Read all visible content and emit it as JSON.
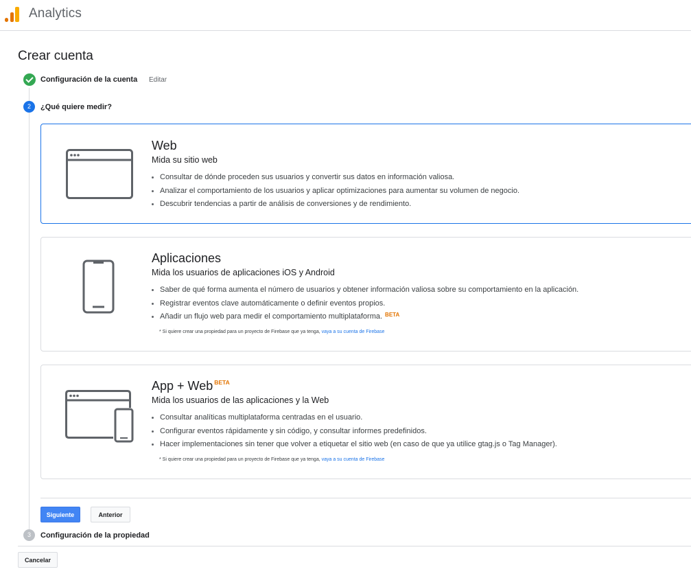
{
  "app": {
    "title": "Analytics"
  },
  "page": {
    "title": "Crear cuenta"
  },
  "steps": {
    "step1": {
      "title": "Configuración de la cuenta",
      "edit_label": "Editar"
    },
    "step2": {
      "number": "2",
      "title": "¿Qué quiere medir?"
    },
    "step3": {
      "number": "3",
      "title": "Configuración de la propiedad"
    }
  },
  "cards": {
    "web": {
      "title": "Web",
      "subtitle": "Mida su sitio web",
      "bullets": [
        "Consultar de dónde proceden sus usuarios y convertir sus datos en información valiosa.",
        "Analizar el comportamiento de los usuarios y aplicar optimizaciones para aumentar su volumen de negocio.",
        "Descubrir tendencias a partir de análisis de conversiones y de rendimiento."
      ],
      "icon": "browser-window-icon"
    },
    "apps": {
      "title": "Aplicaciones",
      "subtitle": "Mida los usuarios de aplicaciones iOS y Android",
      "bullets": [
        "Saber de qué forma aumenta el número de usuarios y obtener información valiosa sobre su comportamiento en la aplicación.",
        "Registrar eventos clave automáticamente o definir eventos propios.",
        "Añadir un flujo web para medir el comportamiento multiplataforma."
      ],
      "beta": "BETA",
      "note": "* Si quiere crear una propiedad para un proyecto de Firebase que ya tenga, ",
      "note_link": "vaya a su cuenta de Firebase",
      "icon": "mobile-phone-icon"
    },
    "appweb": {
      "title": "App + Web",
      "beta": "BETA",
      "subtitle": "Mida los usuarios de las aplicaciones y la Web",
      "bullets": [
        "Consultar analíticas multiplataforma centradas en el usuario.",
        "Configurar eventos rápidamente y sin código, y consultar informes predefinidos.",
        "Hacer implementaciones sin tener que volver a etiquetar el sitio web (en caso de que ya utilice gtag.js o Tag Manager)."
      ],
      "note": "* Si quiere crear una propiedad para un proyecto de Firebase que ya tenga, ",
      "note_link": "vaya a su cuenta de Firebase",
      "icon": "browser-and-phone-icon"
    }
  },
  "buttons": {
    "next": "Siguiente",
    "previous": "Anterior",
    "cancel": "Cancelar"
  },
  "colors": {
    "accent": "#1a73e8",
    "primary_button": "#4285f4",
    "beta": "#e37400",
    "success": "#34a853"
  }
}
